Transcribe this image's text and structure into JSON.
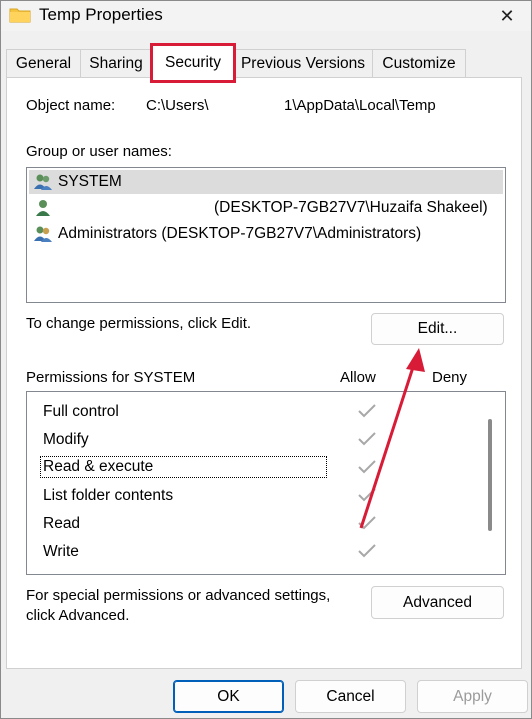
{
  "window": {
    "title": "Temp Properties",
    "close_glyph": "✕"
  },
  "tabs": [
    {
      "label": "General"
    },
    {
      "label": "Sharing"
    },
    {
      "label": "Security"
    },
    {
      "label": "Previous Versions"
    },
    {
      "label": "Customize"
    }
  ],
  "security": {
    "object_name_label": "Object name:",
    "object_name_value_prefix": "C:\\Users\\",
    "object_name_value_suffix": "1\\AppData\\Local\\Temp",
    "group_label": "Group or user names:",
    "users": [
      {
        "name": "SYSTEM",
        "icon": "users-group-icon",
        "selected": true
      },
      {
        "name": "(DESKTOP-7GB27V7\\Huzaifa Shakeel)",
        "icon": "user-icon",
        "selected": false
      },
      {
        "name": "Administrators (DESKTOP-7GB27V7\\Administrators)",
        "icon": "users-group-icon",
        "selected": false
      }
    ],
    "change_hint": "To change permissions, click Edit.",
    "edit_label": "Edit...",
    "permissions_label": "Permissions for SYSTEM",
    "allow_header": "Allow",
    "deny_header": "Deny",
    "permissions": [
      {
        "name": "Full control",
        "allow": true
      },
      {
        "name": "Modify",
        "allow": true
      },
      {
        "name": "Read & execute",
        "allow": true
      },
      {
        "name": "List folder contents",
        "allow": true
      },
      {
        "name": "Read",
        "allow": true
      },
      {
        "name": "Write",
        "allow": true
      }
    ],
    "advanced_hint_line1": "For special permissions or advanced settings,",
    "advanced_hint_line2": "click Advanced.",
    "advanced_label": "Advanced"
  },
  "footer": {
    "ok_label": "OK",
    "cancel_label": "Cancel",
    "apply_label": "Apply"
  },
  "colors": {
    "highlight": "#d81b36",
    "accent": "#005fb8"
  }
}
